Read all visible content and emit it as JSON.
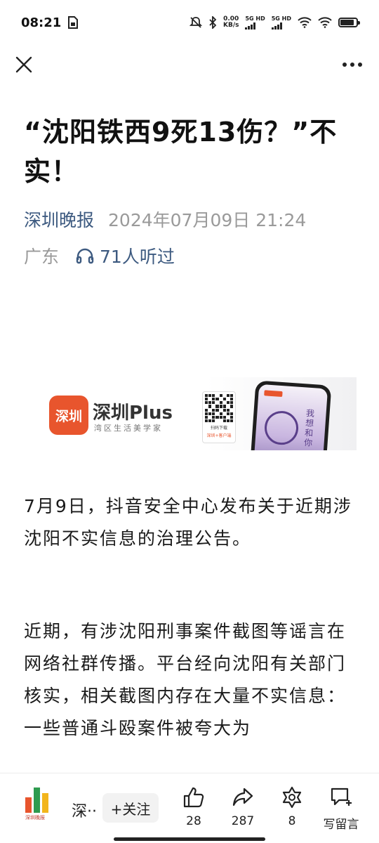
{
  "status_bar": {
    "time": "08:21",
    "net_speed_value": "0.00",
    "net_speed_unit": "KB/s",
    "sim1_label": "5G HD",
    "sim2_label": "5G HD",
    "battery_level": 0.85
  },
  "nav": {
    "close_icon": "close-icon",
    "more_icon": "more-icon"
  },
  "article": {
    "title": "“沈阳铁西9死13伤？”不实！",
    "source": "深圳晚报",
    "publish_time": "2024年07月09日 21:24",
    "region": "广东",
    "listen_count": "71人听过"
  },
  "banner": {
    "logo_text": "深圳",
    "brand": "深圳Plus",
    "slogan": "湾区生活美学家",
    "qr_caption": "扫码下载",
    "qr_caption2": "深圳+客户端",
    "phone_text": "我想和你"
  },
  "body": {
    "paragraphs": [
      "7月9日，抖音安全中心发布关于近期涉沈阳不实信息的治理公告。",
      "近期，有涉沈阳刑事案件截图等谣言在网络社群传播。平台经向沈阳有关部门核实，相关截图内存在大量不实信息：一些普通斗殴案件被夸大为"
    ]
  },
  "bottom_bar": {
    "logo_caption": "深圳晚报",
    "account_name": "深··",
    "follow_label": "+关注",
    "like_count": "28",
    "share_count": "287",
    "favorite_count": "8",
    "comment_label": "写留言"
  },
  "colors": {
    "accent": "#3d5a80",
    "muted": "#9a9a9a",
    "brand_orange": "#e8552d"
  }
}
